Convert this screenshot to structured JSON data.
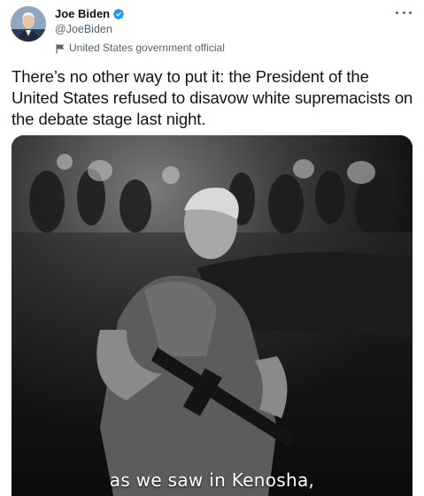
{
  "author": {
    "display_name": "Joe Biden",
    "handle": "@JoeBiden",
    "verified": true,
    "label": "United States government official",
    "avatar_icon": "profile-photo"
  },
  "tweet": {
    "text": "There’s no other way to put it: the President of the United States refused to disavow white supremacists on the debate stage last night."
  },
  "media": {
    "type": "video",
    "caption": "as we saw in Kenosha,"
  },
  "icons": {
    "verified": "verified-badge-icon",
    "label": "government-flag-icon",
    "more": "more-options-icon"
  },
  "colors": {
    "verified": "#1d9bf0",
    "text": "#0f1419",
    "secondary": "#536471"
  }
}
